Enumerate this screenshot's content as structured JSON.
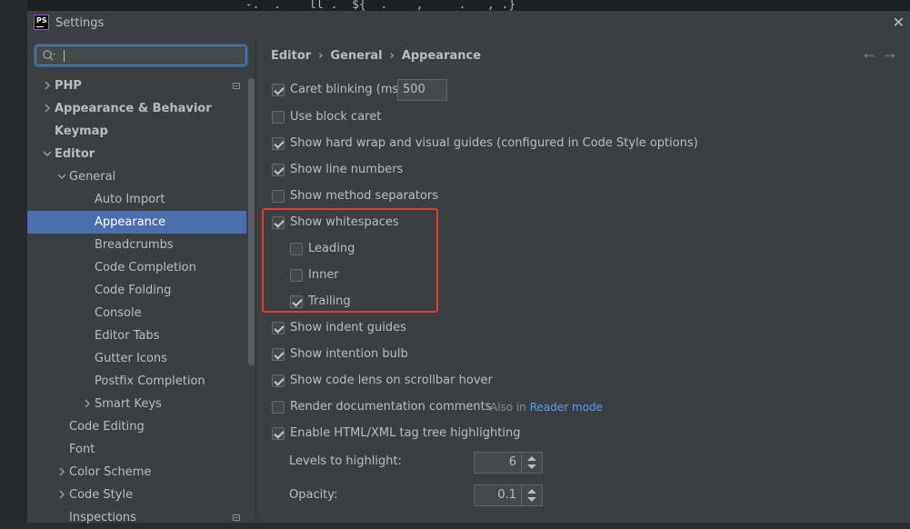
{
  "window": {
    "title": "Settings",
    "app_icon": "PS"
  },
  "background_code": "       -.  .    ll .  ${  .    ,     .   , .}",
  "search": {
    "value": "",
    "placeholder": ""
  },
  "tree": [
    {
      "label": "PHP",
      "level": 0,
      "arrow": "right",
      "bold": true,
      "badge": true
    },
    {
      "label": "Appearance & Behavior",
      "level": 0,
      "arrow": "right",
      "bold": true,
      "badge": false
    },
    {
      "label": "Keymap",
      "level": 0,
      "arrow": "none",
      "bold": true,
      "badge": false
    },
    {
      "label": "Editor",
      "level": 0,
      "arrow": "down",
      "bold": true,
      "badge": false
    },
    {
      "label": "General",
      "level": 1,
      "arrow": "down",
      "bold": false,
      "badge": false
    },
    {
      "label": "Auto Import",
      "level": 2,
      "arrow": "none",
      "bold": false,
      "badge": false
    },
    {
      "label": "Appearance",
      "level": 2,
      "arrow": "none",
      "bold": false,
      "badge": false,
      "selected": true
    },
    {
      "label": "Breadcrumbs",
      "level": 2,
      "arrow": "none",
      "bold": false,
      "badge": false
    },
    {
      "label": "Code Completion",
      "level": 2,
      "arrow": "none",
      "bold": false,
      "badge": false
    },
    {
      "label": "Code Folding",
      "level": 2,
      "arrow": "none",
      "bold": false,
      "badge": false
    },
    {
      "label": "Console",
      "level": 2,
      "arrow": "none",
      "bold": false,
      "badge": false
    },
    {
      "label": "Editor Tabs",
      "level": 2,
      "arrow": "none",
      "bold": false,
      "badge": false
    },
    {
      "label": "Gutter Icons",
      "level": 2,
      "arrow": "none",
      "bold": false,
      "badge": false
    },
    {
      "label": "Postfix Completion",
      "level": 2,
      "arrow": "none",
      "bold": false,
      "badge": false
    },
    {
      "label": "Smart Keys",
      "level": 2,
      "arrow": "right",
      "bold": false,
      "badge": false
    },
    {
      "label": "Code Editing",
      "level": 1,
      "arrow": "none",
      "bold": false,
      "badge": false
    },
    {
      "label": "Font",
      "level": 1,
      "arrow": "none",
      "bold": false,
      "badge": false
    },
    {
      "label": "Color Scheme",
      "level": 1,
      "arrow": "right",
      "bold": false,
      "badge": false
    },
    {
      "label": "Code Style",
      "level": 1,
      "arrow": "right",
      "bold": false,
      "badge": false
    },
    {
      "label": "Inspections",
      "level": 1,
      "arrow": "none",
      "bold": false,
      "badge": true
    }
  ],
  "breadcrumb": [
    "Editor",
    "General",
    "Appearance"
  ],
  "options": {
    "caret_blinking": {
      "label": "Caret blinking (ms):",
      "checked": true,
      "value": "500"
    },
    "block_caret": {
      "label": "Use block caret",
      "checked": false
    },
    "hard_wrap": {
      "label": "Show hard wrap and visual guides (configured in Code Style options)",
      "checked": true
    },
    "line_numbers": {
      "label": "Show line numbers",
      "checked": true
    },
    "method_separators": {
      "label": "Show method separators",
      "checked": false
    },
    "whitespaces": {
      "label": "Show whitespaces",
      "checked": true
    },
    "leading": {
      "label": "Leading",
      "checked": false
    },
    "inner": {
      "label": "Inner",
      "checked": false
    },
    "trailing": {
      "label": "Trailing",
      "checked": true
    },
    "indent_guides": {
      "label": "Show indent guides",
      "checked": true
    },
    "intention_bulb": {
      "label": "Show intention bulb",
      "checked": true
    },
    "code_lens": {
      "label": "Show code lens on scrollbar hover",
      "checked": true
    },
    "render_docs": {
      "label": "Render documentation comments",
      "checked": false,
      "hint_prefix": "Also in",
      "hint_link": "Reader mode"
    },
    "tag_tree": {
      "label": "Enable HTML/XML tag tree highlighting",
      "checked": true
    },
    "levels": {
      "label": "Levels to highlight:",
      "value": "6"
    },
    "opacity": {
      "label": "Opacity:",
      "value": "0.1"
    }
  },
  "colors": {
    "accent": "#4b6eaf",
    "link": "#589df6",
    "highlight_box": "#e53935"
  }
}
